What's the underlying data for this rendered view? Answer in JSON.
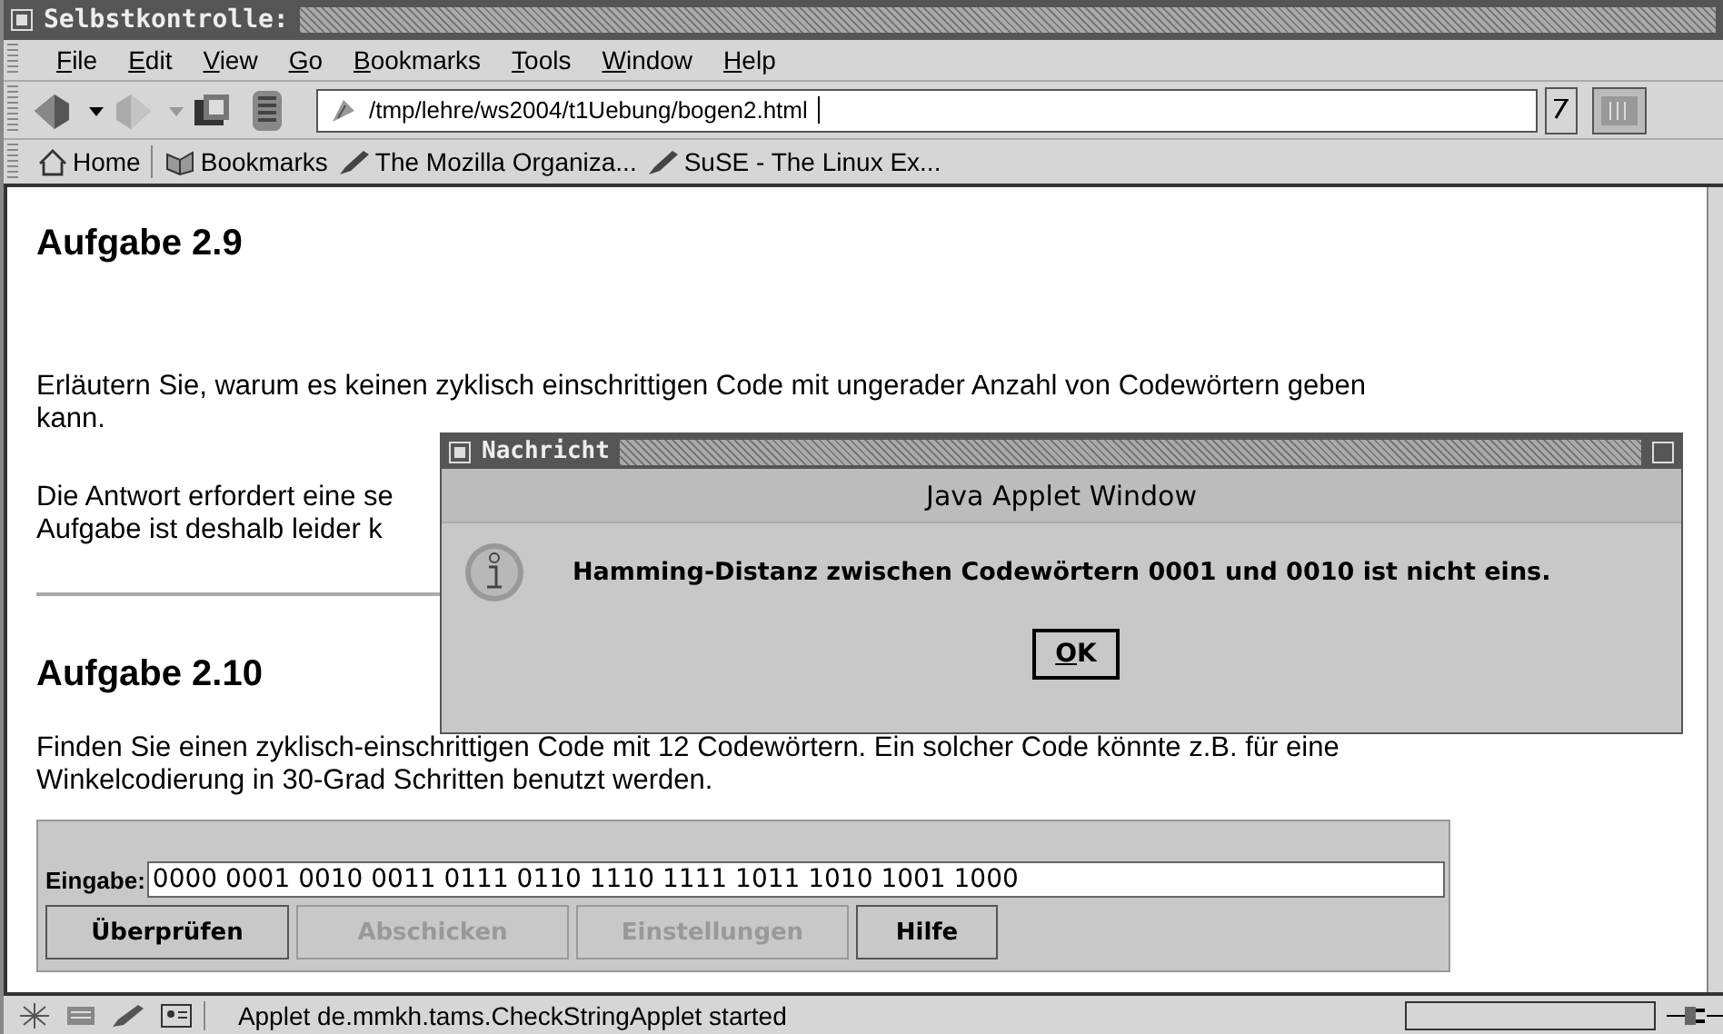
{
  "window": {
    "title": "Selbstkontrolle:"
  },
  "menu": [
    "File",
    "Edit",
    "View",
    "Go",
    "Bookmarks",
    "Tools",
    "Window",
    "Help"
  ],
  "url": "/tmp/lehre/ws2004/t1Uebung/bogen2.html",
  "bookmarks": [
    {
      "label": "Home",
      "kind": "home"
    },
    {
      "label": "Bookmarks",
      "kind": "folder"
    },
    {
      "label": "The Mozilla Organiza...",
      "kind": "link"
    },
    {
      "label": "SuSE - The Linux Ex...",
      "kind": "link"
    }
  ],
  "content": [
    {
      "kind": "heading",
      "text": "Aufgabe 2.9"
    },
    {
      "kind": "paragraph",
      "lines": [
        "Erläutern Sie, warum es keinen zyklisch einschrittigen Code mit ungerader Anzahl von Codewörtern geben",
        "kann."
      ]
    },
    {
      "kind": "paragraph",
      "lines": [
        "Die Antwort erfordert eine se",
        "Aufgabe ist deshalb leider k"
      ]
    },
    {
      "kind": "rule"
    },
    {
      "kind": "heading",
      "text": "Aufgabe 2.10"
    },
    {
      "kind": "paragraph",
      "lines": [
        "Finden Sie einen zyklisch-einschrittigen Code mit 12 Codewörtern. Ein solcher Code könnte z.B. für eine",
        "Winkelcodierung in 30-Grad Schritten benutzt werden."
      ]
    }
  ],
  "applet": {
    "label": "Eingabe:",
    "value": "0000 0001 0010 0011 0111 0110 1110 1111 1011 1010 1001 1000",
    "buttons": [
      {
        "label": "Überprüfen",
        "disabled": false
      },
      {
        "label": "Abschicken",
        "disabled": true
      },
      {
        "label": "Einstellungen",
        "disabled": true
      },
      {
        "label": "Hilfe",
        "disabled": false
      }
    ]
  },
  "dialog": {
    "title": "Nachricht",
    "banner": "Java Applet Window",
    "message": "Hamming-Distanz zwischen Codewörtern 0001 und 0010 ist nicht eins.",
    "button": "OK"
  },
  "status_bar": {
    "text": "Applet de.mmkh.tams.CheckStringApplet started"
  }
}
